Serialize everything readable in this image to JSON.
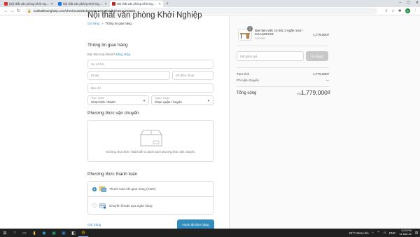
{
  "browser": {
    "tabs": [
      {
        "title": "[Nội thất văn phòng Khởi Nghiệ",
        "active": false,
        "favicon_color": "#d93025"
      },
      {
        "title": "Nội thất văn phòng Khởi Nghiệp",
        "active": false,
        "favicon_color": "#1a73e8"
      },
      {
        "title": "Nội thất văn phòng Khởi Nghiệp",
        "active": true,
        "favicon_color": "#c5221f"
      }
    ],
    "new_tab": "+",
    "url": "noithatkhoinghiep.com/checkouts/23cbc5eaaea4439bad51fe21cc4eda62",
    "window_controls": [
      "–",
      "▢",
      "✕"
    ]
  },
  "page": {
    "shop_title": "Nội thất văn phòng Khởi Nghiệp",
    "breadcrumb": {
      "cart": "Giỏ hàng",
      "separator": ">",
      "current": "Thông tin giao hàng"
    },
    "shipping_info_title": "Thông tin giao hàng",
    "login_prompt": "Bạn đã có tài khoản?",
    "login_link": "Đăng nhập",
    "fields": {
      "fullname": "Họ và tên",
      "email": "Email",
      "phone": "Số điện thoại",
      "address": "Địa chỉ",
      "province_label": "Tỉnh / thành",
      "province_value": "Chọn tỉnh / thành",
      "district_label": "Quận / huyện",
      "district_value": "Chọn quận / huyện"
    },
    "shipping_method_title": "Phương thức vận chuyển",
    "shipping_message": "Vui lòng chọn tỉnh / thành để có danh sách phương thức vận chuyển.",
    "payment_method_title": "Phương thức thanh toán",
    "payment_options": [
      {
        "label": "Thanh toán khi giao hàng (COD)",
        "selected": true
      },
      {
        "label": "Chuyển khoản qua ngân hàng",
        "selected": false
      }
    ],
    "cart_link": "Giỏ hàng",
    "submit_label": "Hoàn tất đơn hàng"
  },
  "order_summary": {
    "product": {
      "name": "Bàn làm việc có hộc 3 ngăn 1m2 - KHA120HO3",
      "sku": "COD*600",
      "quantity": "1",
      "price": "1,779,000₫"
    },
    "coupon_placeholder": "Mã giảm giá",
    "coupon_button": "Sử dụng",
    "subtotal_label": "Tạm tính",
    "subtotal_value": "1,779,000₫",
    "shipping_label": "Phí vận chuyển",
    "shipping_value": "—",
    "total_label": "Tổng cộng",
    "total_currency": "VND",
    "total_value": "1,779,000₫"
  },
  "taskbar": {
    "weather": "22°C  Mưa nhỏ",
    "time": "6:03 PM",
    "date": "11-Mar-22",
    "language": "ENG"
  },
  "colors": {
    "accent": "#338dbc",
    "button_disabled": "#c8c8c8",
    "sidebar_bg": "#fafafa"
  }
}
